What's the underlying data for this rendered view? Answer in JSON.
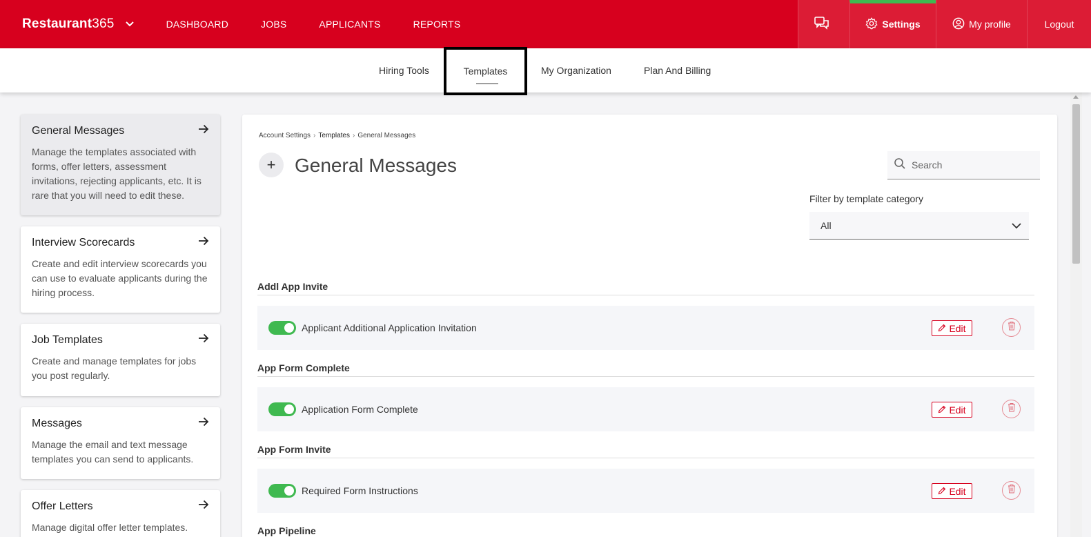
{
  "brand": {
    "name_bold": "Restaurant",
    "name_light": "365"
  },
  "topnav": {
    "links": [
      "DASHBOARD",
      "JOBS",
      "APPLICANTS",
      "REPORTS"
    ]
  },
  "navright": {
    "settings": "Settings",
    "profile": "My profile",
    "logout": "Logout"
  },
  "subnav": {
    "tabs": [
      "Hiring Tools",
      "Templates",
      "My Organization",
      "Plan And Billing"
    ],
    "active": "Templates"
  },
  "sidebar": {
    "cards": [
      {
        "title": "General Messages",
        "desc": "Manage the templates associated with forms, offer letters, assessment invitations, rejecting applicants, etc. It is rare that you will need to edit these."
      },
      {
        "title": "Interview Scorecards",
        "desc": "Create and edit interview scorecards you can use to evaluate applicants during the hiring process."
      },
      {
        "title": "Job Templates",
        "desc": "Create and manage templates for jobs you post regularly."
      },
      {
        "title": "Messages",
        "desc": "Manage the email and text message templates you can send to applicants."
      },
      {
        "title": "Offer Letters",
        "desc": "Manage digital offer letter templates."
      }
    ]
  },
  "main": {
    "breadcrumb": [
      "Account Settings",
      "Templates",
      "General Messages"
    ],
    "title": "General Messages",
    "add_label": "+",
    "search_placeholder": "Search",
    "filter_label": "Filter by template category",
    "filter_value": "All",
    "edit_label": "Edit",
    "sections": [
      {
        "header": "Addl App Invite",
        "item": "Applicant Additional Application Invitation",
        "enabled": true
      },
      {
        "header": "App Form Complete",
        "item": "Application Form Complete",
        "enabled": true
      },
      {
        "header": "App Form Invite",
        "item": "Required Form Instructions",
        "enabled": true
      },
      {
        "header": "App Pipeline"
      }
    ]
  },
  "colors": {
    "brand_red": "#d7001e",
    "toggle_on": "#3fb950"
  }
}
